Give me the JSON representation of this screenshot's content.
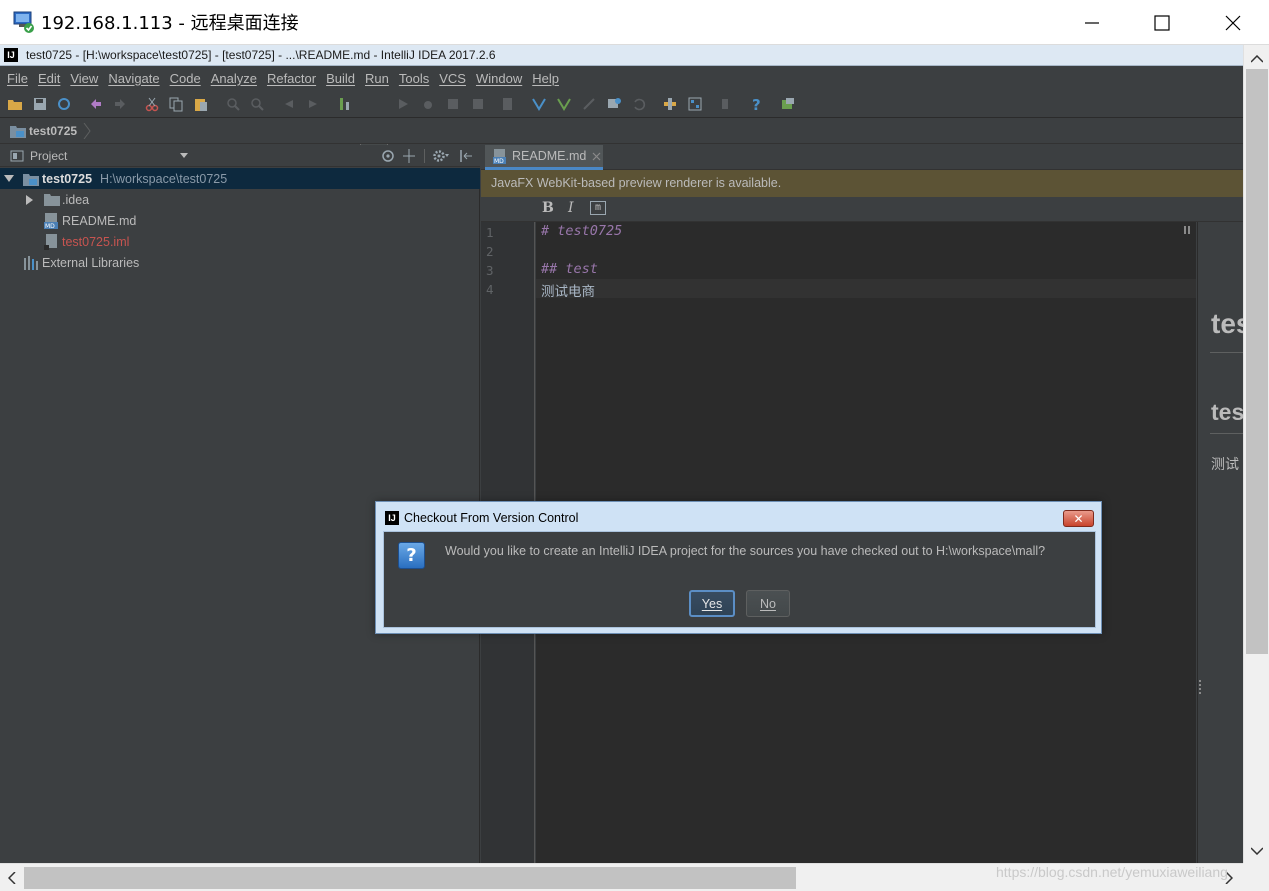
{
  "rdp_window": {
    "title": "192.168.1.113 - 远程桌面连接"
  },
  "ide": {
    "title": "test0725 - [H:\\workspace\\test0725] - [test0725] - ...\\README.md - IntelliJ IDEA 2017.2.6",
    "logo": "IJ",
    "menu": [
      "File",
      "Edit",
      "View",
      "Navigate",
      "Code",
      "Analyze",
      "Refactor",
      "Build",
      "Run",
      "Tools",
      "VCS",
      "Window",
      "Help"
    ],
    "breadcrumb": "test0725",
    "project_panel": {
      "title": "Project",
      "root": {
        "name": "test0725",
        "path": "H:\\workspace\\test0725"
      },
      "items": [
        ".idea",
        "README.md",
        "test0725.iml"
      ],
      "external": "External Libraries"
    },
    "editor": {
      "tab": "README.md",
      "notice": "JavaFX WebKit-based preview renderer is available.",
      "md_toolbar": {
        "bold": "B",
        "italic": "I",
        "code": "m"
      },
      "line_numbers": [
        "1",
        "2",
        "3",
        "4"
      ],
      "lines": [
        "# test0725",
        "",
        "## test",
        "测试电商"
      ],
      "preview": {
        "h1": "tes",
        "h2": "tes",
        "text": "测试"
      }
    },
    "colors": {
      "background": "#3c3f41",
      "editor_bg": "#2b2b2b",
      "heading": "#9876aa",
      "error_file": "#c75450",
      "notice_bg": "#5c5335"
    }
  },
  "dialog": {
    "title": "Checkout From Version Control",
    "message": "Would you like to create an IntelliJ IDEA project for the sources you have checked out to H:\\workspace\\mall?",
    "yes": "Yes",
    "no": "No",
    "close": "✕"
  },
  "watermark": "https://blog.csdn.net/yemuxiaweiliang"
}
